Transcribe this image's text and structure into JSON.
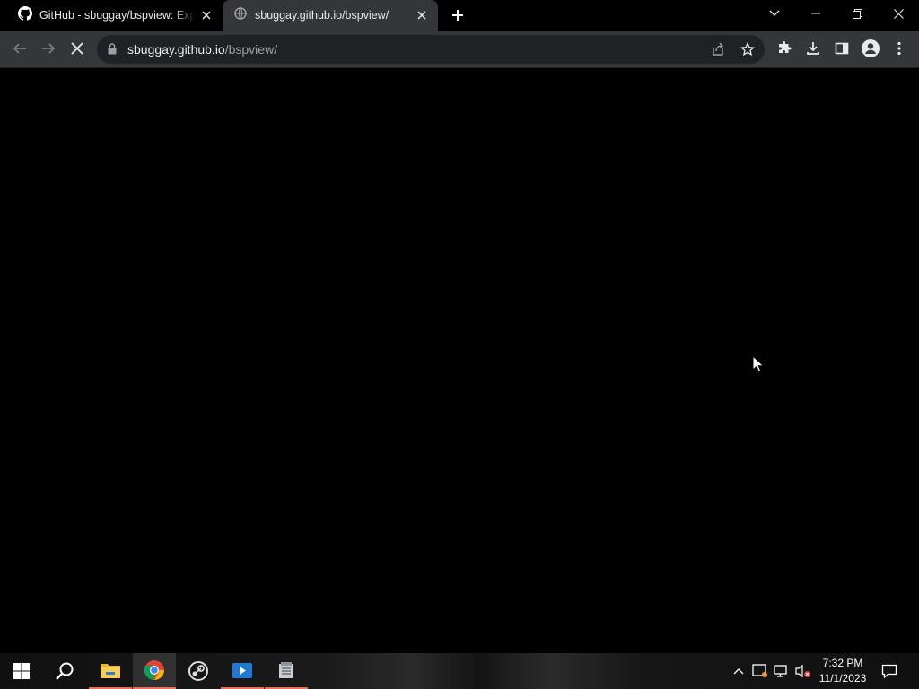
{
  "browser": {
    "tabs": [
      {
        "title": "GitHub - sbuggay/bspview: Expl",
        "icon": "github-icon",
        "active": false
      },
      {
        "title": "sbuggay.github.io/bspview/",
        "icon": "loading-globe-icon",
        "active": true
      }
    ],
    "address": {
      "host": "sbuggay.github.io",
      "path": "/bspview/"
    },
    "accent": "#35363a"
  },
  "taskbar": {
    "apps": [
      "start-icon",
      "search-icon",
      "file-explorer-icon",
      "chrome-icon",
      "steam-icon",
      "media-player-icon",
      "app-icon"
    ],
    "clock": {
      "time": "7:32 PM",
      "date": "11/1/2023"
    },
    "indicator_color": "#e6705a"
  }
}
